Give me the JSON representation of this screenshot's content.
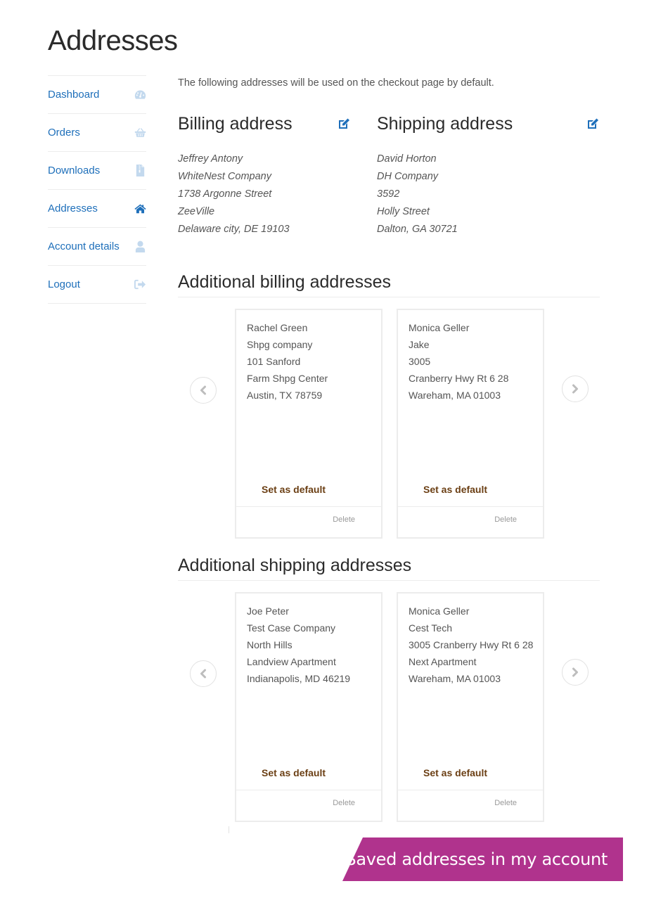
{
  "page": {
    "title": "Addresses"
  },
  "sidebar": {
    "items": [
      {
        "label": "Dashboard",
        "icon": "dashboard-icon",
        "active": false
      },
      {
        "label": "Orders",
        "icon": "basket-icon",
        "active": false
      },
      {
        "label": "Downloads",
        "icon": "file-archive-icon",
        "active": false
      },
      {
        "label": "Addresses",
        "icon": "home-icon",
        "active": true
      },
      {
        "label": "Account details",
        "icon": "user-icon",
        "active": false
      },
      {
        "label": "Logout",
        "icon": "sign-out-icon",
        "active": false
      }
    ]
  },
  "main": {
    "intro": "The following addresses will be used on the checkout page by default.",
    "billing": {
      "title": "Billing address",
      "edit_icon": "edit-icon",
      "lines": [
        "Jeffrey Antony",
        "WhiteNest Company",
        "1738 Argonne Street",
        "ZeeVille",
        "Delaware city, DE 19103"
      ]
    },
    "shipping": {
      "title": "Shipping address",
      "edit_icon": "edit-icon",
      "lines": [
        "David Horton",
        "DH Company",
        "3592",
        "Holly Street",
        "Dalton, GA 30721"
      ]
    },
    "additional_billing": {
      "title": "Additional billing addresses",
      "cards": [
        {
          "lines": [
            "Rachel Green",
            "Shpg company",
            "101 Sanford",
            "Farm Shpg Center",
            "Austin, TX 78759"
          ],
          "set_default": "Set as default",
          "delete": "Delete"
        },
        {
          "lines": [
            "Monica Geller",
            "Jake",
            "3005",
            "Cranberry Hwy Rt 6 28",
            "Wareham, MA 01003"
          ],
          "set_default": "Set as default",
          "delete": "Delete"
        }
      ]
    },
    "additional_shipping": {
      "title": "Additional shipping addresses",
      "cards": [
        {
          "lines": [
            "Joe Peter",
            "Test Case Company",
            "North Hills",
            "Landview Apartment",
            "Indianapolis, MD 46219"
          ],
          "set_default": "Set as default",
          "delete": "Delete"
        },
        {
          "lines": [
            "Monica Geller",
            "Cest Tech",
            "3005 Cranberry Hwy Rt 6 28",
            "Next Apartment",
            "Wareham, MA 01003"
          ],
          "set_default": "Set as default",
          "delete": "Delete"
        }
      ]
    }
  },
  "banner": {
    "text": "Saved addresses in my account"
  },
  "colors": {
    "link": "#1e6fba",
    "icon_inactive": "#c3d9ee",
    "icon_active": "#1e6fba",
    "set_default": "#6b3f14",
    "banner_bg": "#b0338d"
  }
}
